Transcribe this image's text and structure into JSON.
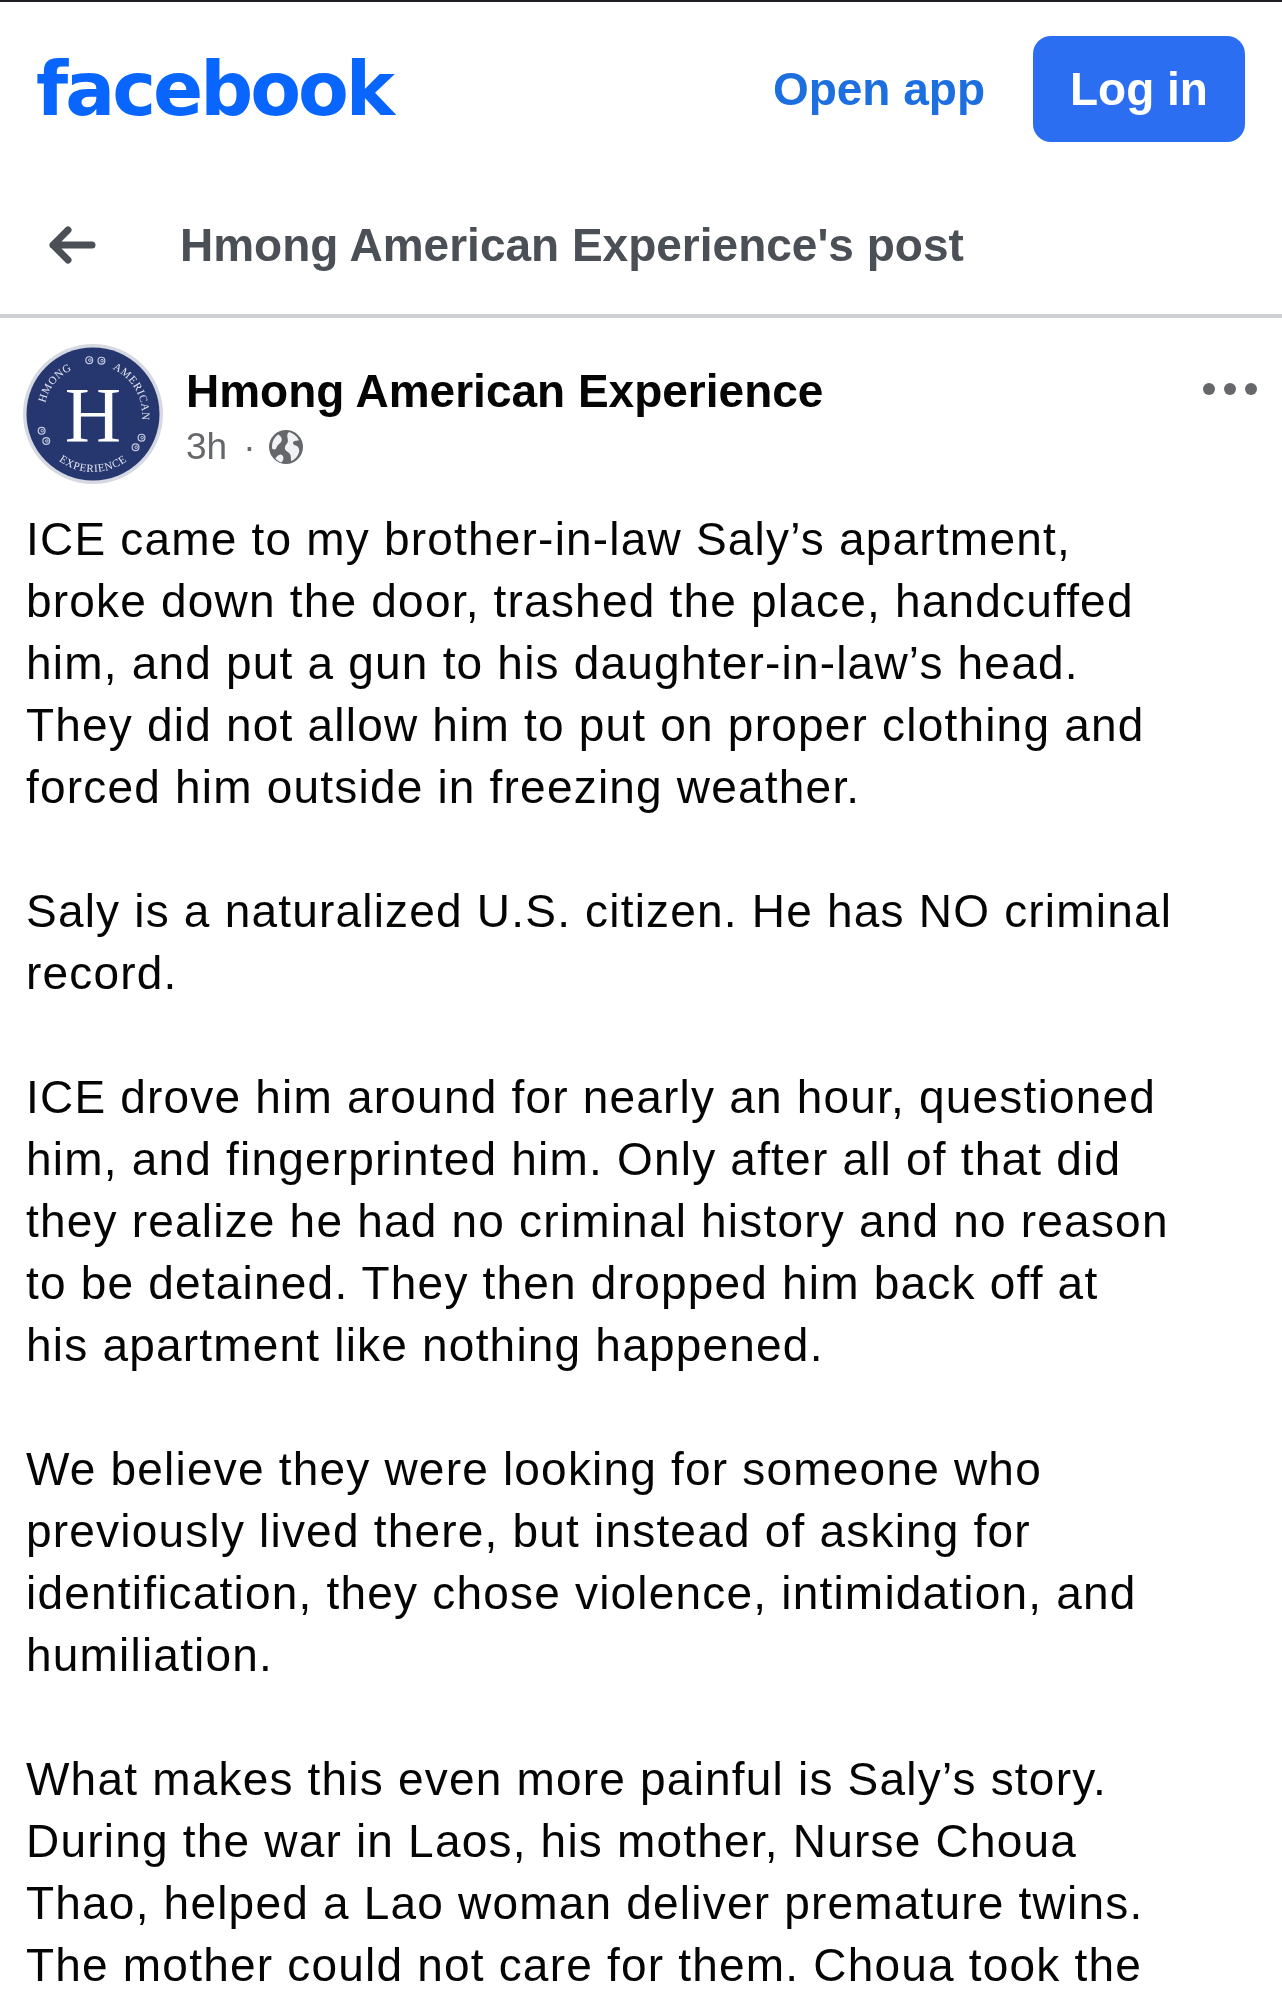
{
  "header": {
    "logo": "facebook",
    "open_app": "Open app",
    "login_button": "Log in"
  },
  "nav": {
    "title": "Hmong American Experience's post"
  },
  "post": {
    "avatar": {
      "letter": "H",
      "ring_text": [
        "HMONG",
        "AMERICAN",
        "EXPERIENCE"
      ]
    },
    "author": "Hmong American Experience",
    "time": "3h",
    "separator": "·",
    "paragraphs": [
      [
        "ICE came to my brother-in-law Saly’s apartment,",
        "broke down the door, trashed the place, handcuffed",
        "him, and put a gun to his daughter-in-law’s head.",
        "They did not allow him to put on proper clothing and",
        "forced him outside in freezing weather."
      ],
      [
        "Saly is a naturalized U.S. citizen. He has NO criminal",
        "record."
      ],
      [
        "ICE drove him around for nearly an hour, questioned",
        "him, and fingerprinted him. Only after all of that did",
        "they realize he had no criminal history and no reason",
        "to be detained. They then dropped him back off at",
        "his apartment like nothing happened."
      ],
      [
        "We believe they were looking for someone who",
        "previously lived there, but instead of asking for",
        "identification, they chose violence, intimidation, and",
        "humiliation."
      ],
      [
        "What makes this even more painful is Saly’s story.",
        "During the war in Laos, his mother, Nurse Choua",
        "Thao, helped a Lao woman deliver premature twins.",
        "The mother could not care for them. Choua took the"
      ]
    ]
  }
}
